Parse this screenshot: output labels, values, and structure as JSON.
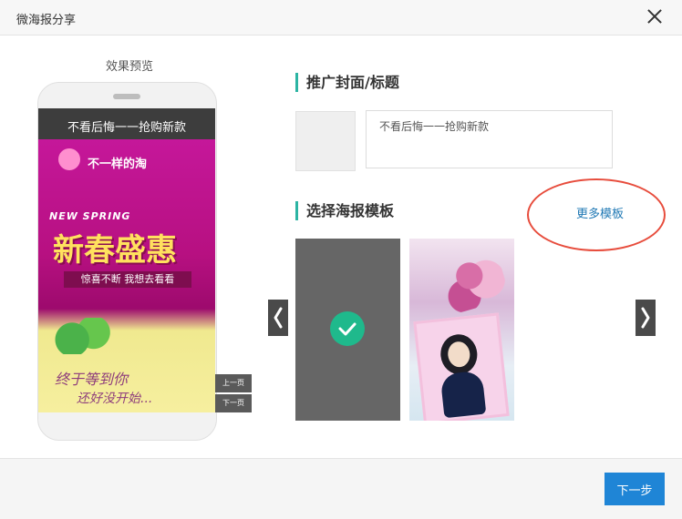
{
  "dialog": {
    "title": "微海报分享"
  },
  "preview": {
    "label": "效果预览",
    "screen_title": "不看后悔一一抢购新款",
    "poster": {
      "brand": "不一样的淘",
      "spring_text": "NEW SPRING",
      "main_text": "新春盛惠",
      "ribbon_text": "惊喜不断 我想去看看",
      "script_line1": "终于等到你",
      "script_line2": "还好没开始..."
    },
    "prev_page": "上一页",
    "next_page": "下一页"
  },
  "promo": {
    "section_title": "推广封面/标题",
    "title_value": "不看后悔一一抢购新款"
  },
  "templates": {
    "section_title": "选择海报模板",
    "more_link": "更多模板"
  },
  "footer": {
    "next_button": "下一步"
  },
  "colors": {
    "accent": "#2cb4a3",
    "link": "#1f78b4",
    "button": "#1f85d6",
    "highlight": "#e74c3c"
  }
}
